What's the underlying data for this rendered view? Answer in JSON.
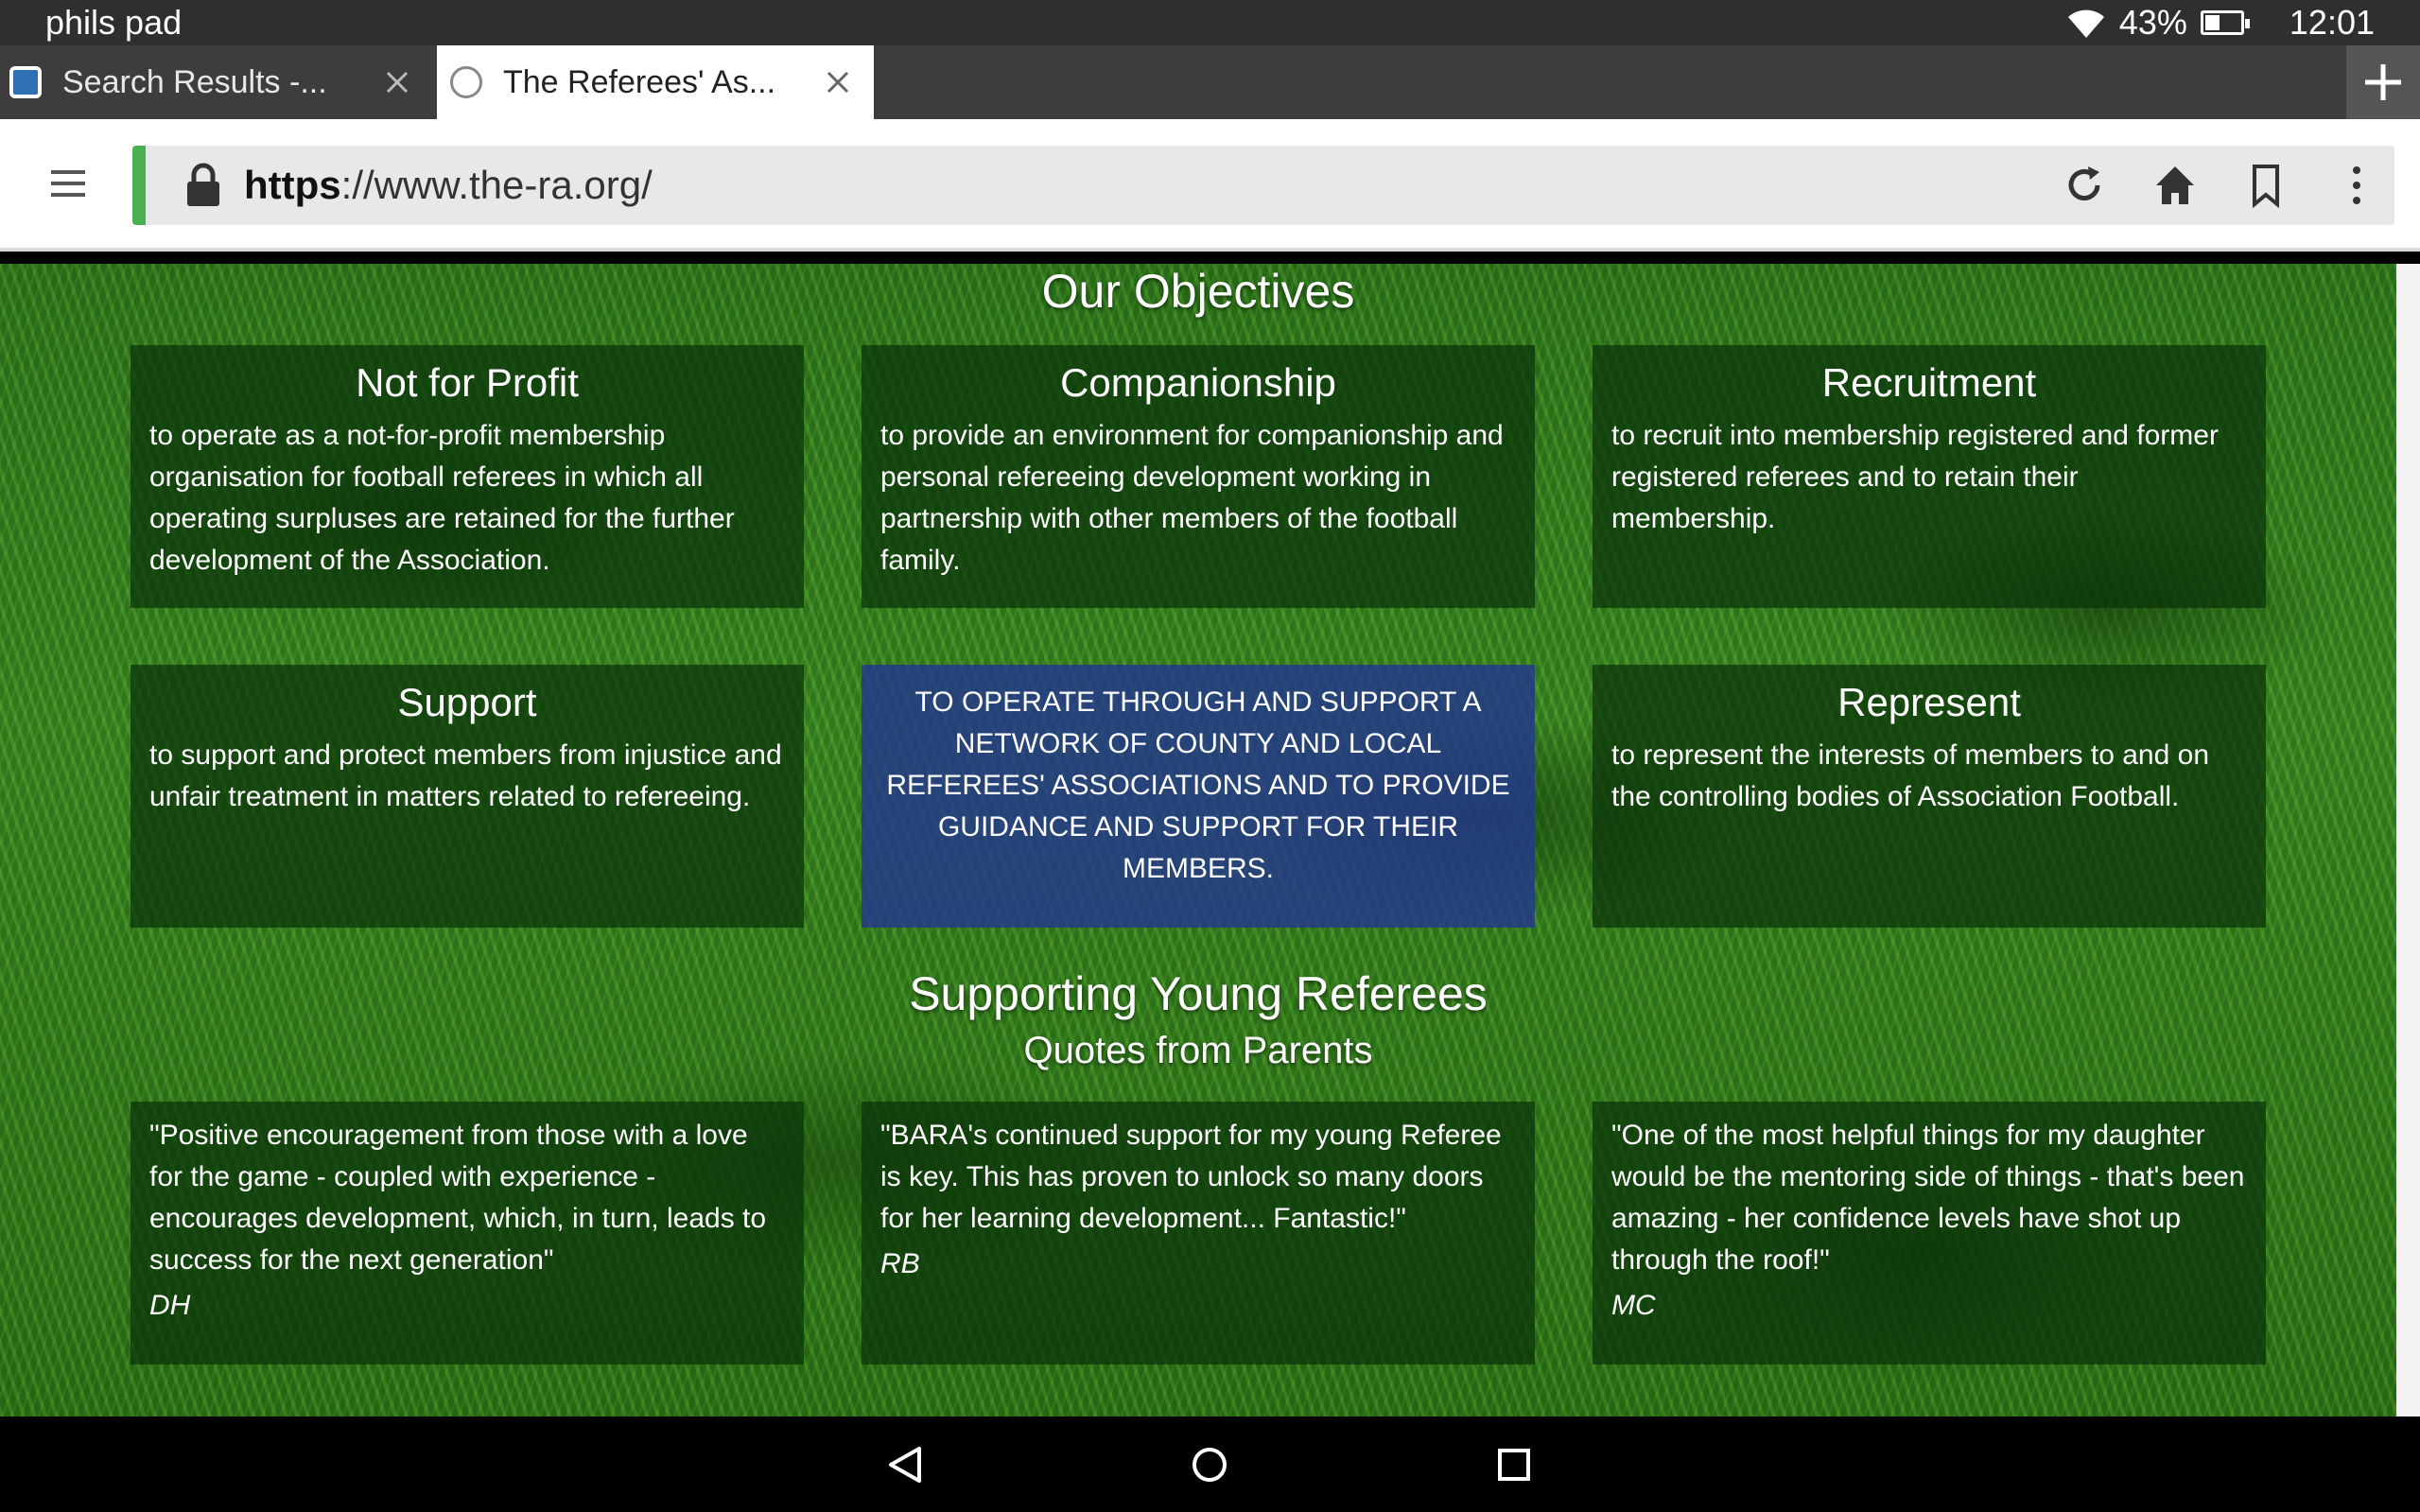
{
  "status_bar": {
    "device_name": "phils pad",
    "battery_percent": "43%",
    "battery_level": 0.43,
    "time": "12:01"
  },
  "tabs": [
    {
      "title": "Search Results -...",
      "active": false
    },
    {
      "title": "The Referees' As...",
      "active": true
    }
  ],
  "toolbar": {
    "url_scheme": "https",
    "url_rest": "://www.the-ra.org/"
  },
  "page": {
    "objectives_title": "Our Objectives",
    "objectives": [
      {
        "title": "Not for Profit",
        "text": "to operate as a not-for-profit membership organisation for football referees in which all operating surpluses are retained for the further development of the Association."
      },
      {
        "title": "Companionship",
        "text": "to provide an environment for companionship and personal refereeing development working in partnership with other members of the football family."
      },
      {
        "title": "Recruitment",
        "text": "to recruit into membership registered and former registered referees and to retain their membership."
      },
      {
        "title": "Support",
        "text": "to support and protect members from injustice and unfair treatment in matters related to refereeing."
      },
      {
        "title": "",
        "text": "TO OPERATE THROUGH AND SUPPORT A NETWORK OF COUNTY AND LOCAL REFEREES' ASSOCIATIONS AND TO PROVIDE GUIDANCE AND SUPPORT FOR THEIR MEMBERS."
      },
      {
        "title": "Represent",
        "text": "to represent the interests of members to and on the controlling bodies of Association Football."
      }
    ],
    "young_title": "Supporting Young Referees",
    "quotes_subtitle": "Quotes from Parents",
    "quotes": [
      {
        "text": "\"Positive encouragement from those with a love for the game - coupled with experience - encourages development, which, in turn, leads to success for the next generation\"",
        "author": "DH"
      },
      {
        "text": "\"BARA's continued support for my young Referee is key. This has proven to unlock so many doors for her learning development... Fantastic!\"",
        "author": "RB"
      },
      {
        "text": "\"One of the most helpful things for my daughter would be the mentoring side of things - that's been amazing - her confidence levels have shot up through the roof!\"",
        "author": "MC"
      }
    ]
  },
  "colors": {
    "url_indicator": "#4caf50",
    "card_bg": "#0a320a",
    "highlight_card_bg": "#23378c"
  }
}
